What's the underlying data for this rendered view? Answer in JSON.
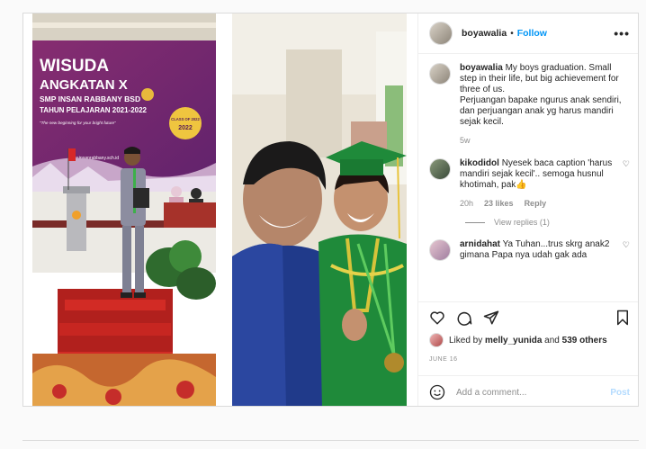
{
  "photos": {
    "left_banner": {
      "line1": "WISUDA",
      "line2": "ANGKATAN X",
      "line3": "SMP INSAN RABBANY BSD",
      "line4": "TAHUN PELAJARAN 2021-2022",
      "tagline": "\"The new beginning for your bright future\"",
      "url": "www.insanrabbany.sch.id",
      "badge": "CLASS OF 2022"
    }
  },
  "header": {
    "username": "boyawalia",
    "separator": "•",
    "follow": "Follow",
    "more": "•••"
  },
  "caption": {
    "username": "boyawalia",
    "text": "My boys graduation. Small step in their life, but big achievement for three of us.",
    "text2": "Perjuangan bapake ngurus anak sendiri, dan perjuangan anak yg harus mandiri sejak kecil.",
    "time": "5w"
  },
  "comments": [
    {
      "username": "kikodidol",
      "text": "Nyesek baca caption 'harus mandiri sejak kecil'.. semoga husnul khotimah, pak👍",
      "time": "20h",
      "likes": "23 likes",
      "reply": "Reply"
    },
    {
      "username": "arnidahat",
      "text": "Ya Tuhan...trus skrg anak2 gimana Papa nya udah gak ada"
    }
  ],
  "view_replies": "View replies (1)",
  "likes": {
    "prefix": "Liked by",
    "user": "melly_yunida",
    "and": "and",
    "count": "539 others"
  },
  "date": "JUNE 16",
  "add_comment": {
    "placeholder": "Add a comment...",
    "post": "Post"
  },
  "colors": {
    "accent": "#0095f6",
    "banner": "#7b2a6e",
    "gown": "#1f8a3a"
  }
}
